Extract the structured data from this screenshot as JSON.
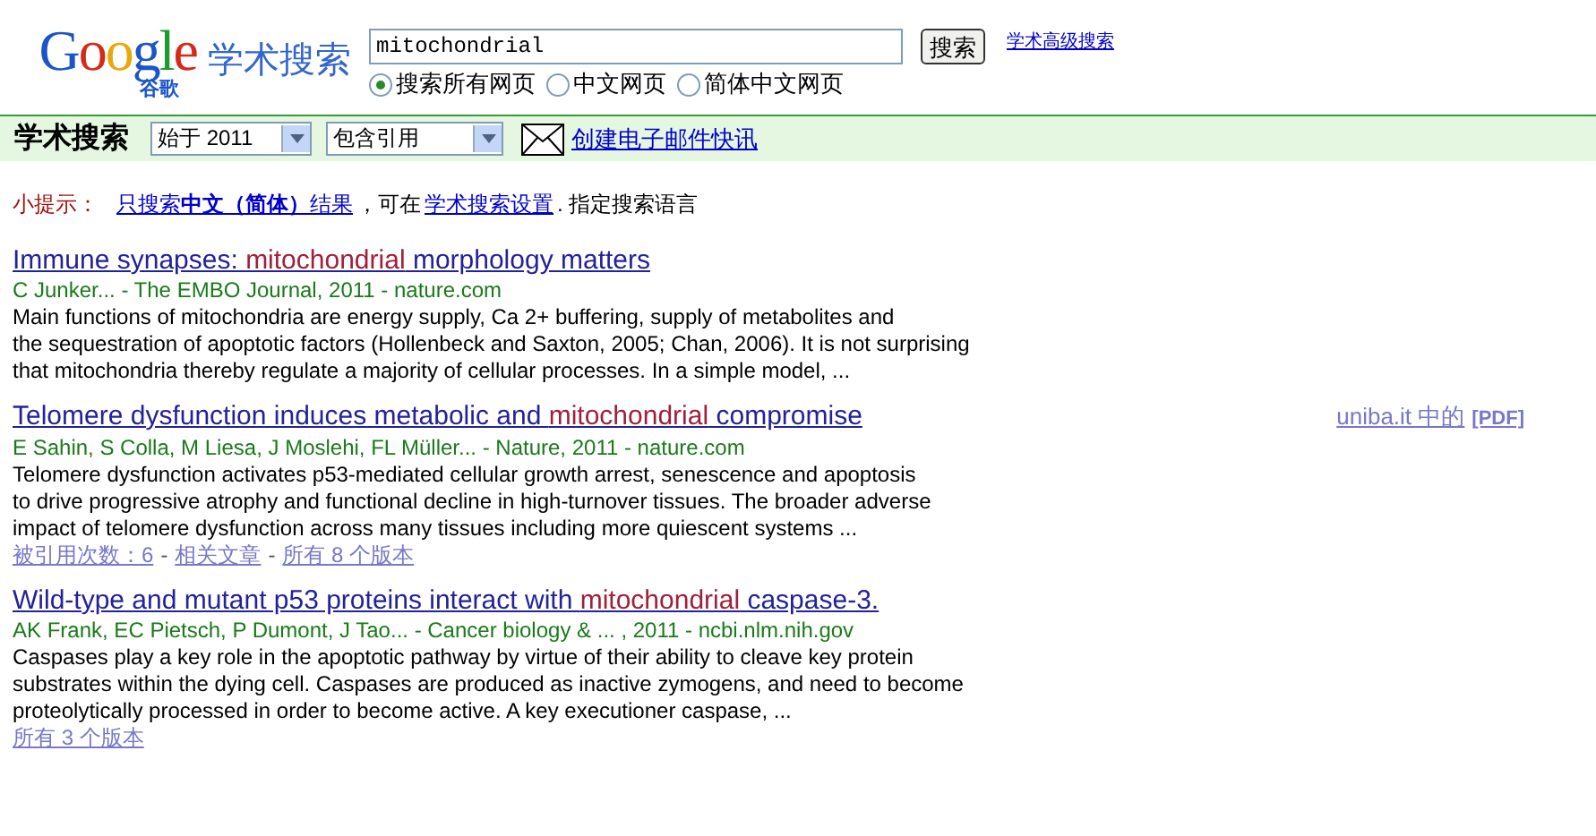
{
  "logo": {
    "wordmark": "Google",
    "sub": "谷歌",
    "product": "学术搜索"
  },
  "search": {
    "value": "mitochondrial",
    "button": "搜索",
    "advanced_link": "学术高级搜索",
    "scopes": [
      {
        "label": "搜索所有网页",
        "selected": true
      },
      {
        "label": "中文网页",
        "selected": false
      },
      {
        "label": "简体中文网页",
        "selected": false
      }
    ]
  },
  "bar": {
    "title": "学术搜索",
    "year_select": "始于 2011",
    "citation_select": "包含引用",
    "alert_link": "创建电子邮件快讯"
  },
  "tip": {
    "label": "小提示：",
    "link1": "只搜索**中文（简体）**结果",
    "text1": "，可在 ",
    "link2": "学术搜索设置",
    "text2": ". 指定搜索语言"
  },
  "results": [
    {
      "title": [
        {
          "text": "Immune synapses: ",
          "highlight": false
        },
        {
          "text": "mitochondrial",
          "highlight": true
        },
        {
          "text": " morphology matters",
          "highlight": false
        }
      ],
      "meta": "C Junker... - The EMBO Journal, 2011 - nature.com",
      "snippet": [
        "Main functions of mitochondria are energy supply, Ca 2+ buffering, supply of metabolites and",
        "the sequestration of apoptotic factors (Hollenbeck and Saxton, 2005; Chan, 2006). It is not surprising",
        "that mitochondria thereby regulate a majority of cellular processes. In a simple model, ..."
      ]
    },
    {
      "title": [
        {
          "text": "Telomere dysfunction induces metabolic and ",
          "highlight": false
        },
        {
          "text": "mitochondrial",
          "highlight": true
        },
        {
          "text": " compromise",
          "highlight": false
        }
      ],
      "side": {
        "source": "uniba.it 中的",
        "format": "[PDF]"
      },
      "meta": "E Sahin, S Colla, M Liesa, J Moslehi, FL Müller... - Nature, 2011 - nature.com",
      "snippet": [
        "Telomere dysfunction activates p53-mediated cellular growth arrest, senescence and apoptosis",
        "to drive progressive atrophy and functional decline in high-turnover tissues. The broader adverse",
        "impact of telomere dysfunction across many tissues including more quiescent systems ..."
      ],
      "links": [
        "被引用次数：6",
        "相关文章",
        "所有 8 个版本"
      ],
      "link_separator": "-"
    },
    {
      "title": [
        {
          "text": "Wild-type and mutant p53 proteins interact with ",
          "highlight": false
        },
        {
          "text": "mitochondrial",
          "highlight": true
        },
        {
          "text": " caspase-3.",
          "highlight": false
        }
      ],
      "meta": "AK Frank, EC Pietsch, P Dumont, J Tao... - Cancer biology & ... , 2011 - ncbi.nlm.nih.gov",
      "snippet": [
        "Caspases play a key role in the apoptotic pathway by virtue of their ability to cleave key protein",
        "substrates within the dying cell. Caspases are produced as inactive zymogens, and need to become",
        "proteolytically processed in order to become active. A key executioner caspase, ..."
      ],
      "links": [
        "所有 3 个版本"
      ]
    }
  ]
}
